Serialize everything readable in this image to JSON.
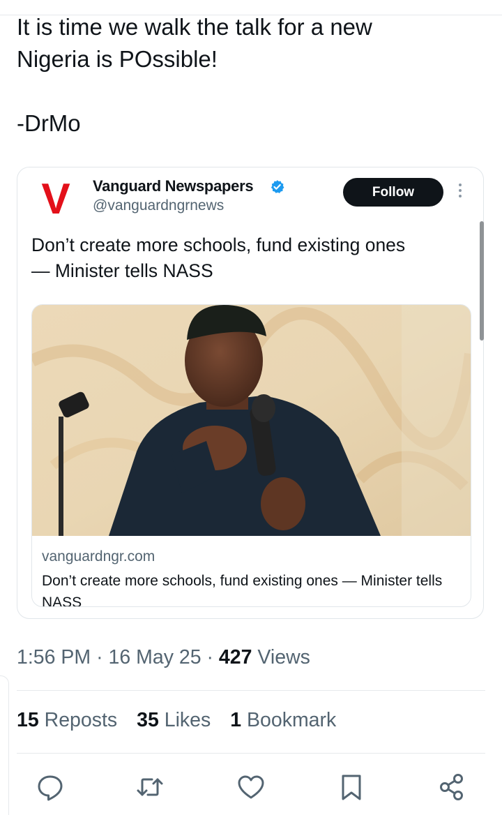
{
  "post": {
    "text_line1": "It is time we walk the talk for a new",
    "text_line2": "Nigeria is POssible!",
    "signature": "-DrMo"
  },
  "quoted": {
    "logo_letter": "V",
    "display_name": "Vanguard Newspapers",
    "handle": "@vanguardngrnews",
    "follow_label": "Follow",
    "text_line1": "Don’t create more schools, fund existing ones",
    "text_line2": "— Minister tells NASS",
    "card_domain": "vanguardngr.com",
    "card_headline": "Don’t create more schools, fund existing ones — Minister tells NASS"
  },
  "meta": {
    "time": "1:56 PM",
    "sep": "·",
    "date": "16 May 25",
    "views_count": "427",
    "views_label": "Views"
  },
  "stats": {
    "reposts_count": "15",
    "reposts_label": "Reposts",
    "likes_count": "35",
    "likes_label": "Likes",
    "bookmarks_count": "1",
    "bookmarks_label": "Bookmark"
  },
  "actions": [
    "reply-icon",
    "repost-icon",
    "like-icon",
    "bookmark-icon",
    "share-icon"
  ],
  "colors": {
    "text_primary": "#0f1419",
    "text_secondary": "#536471",
    "follow_button": "#0f1419",
    "verified_badge": "#1d9bf0",
    "logo_red": "#e3101a",
    "border": "#e1e6ea"
  }
}
